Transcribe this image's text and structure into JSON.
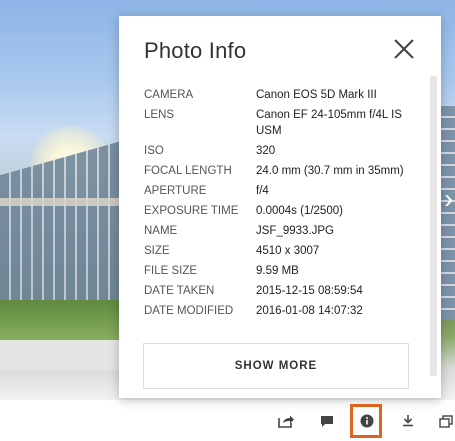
{
  "panel": {
    "title": "Photo Info",
    "rows": [
      {
        "label": "CAMERA",
        "value": "Canon EOS 5D Mark III"
      },
      {
        "label": "LENS",
        "value": "Canon EF 24-105mm f/4L IS USM"
      },
      {
        "label": "ISO",
        "value": "320"
      },
      {
        "label": "FOCAL LENGTH",
        "value": "24.0 mm (30.7 mm in 35mm)"
      },
      {
        "label": "APERTURE",
        "value": "f/4"
      },
      {
        "label": "EXPOSURE TIME",
        "value": "0.0004s (1/2500)"
      },
      {
        "label": "NAME",
        "value": "JSF_9933.JPG"
      },
      {
        "label": "SIZE",
        "value": "4510 x 3007"
      },
      {
        "label": "FILE SIZE",
        "value": "9.59 MB"
      },
      {
        "label": "DATE TAKEN",
        "value": "2015-12-15 08:59:54"
      },
      {
        "label": "DATE MODIFIED",
        "value": "2016-01-08 14:07:32"
      }
    ],
    "show_more_label": "SHOW MORE"
  },
  "toolbar": {
    "icons": [
      "share-icon",
      "comment-icon",
      "info-icon",
      "download-icon",
      "more-icon"
    ],
    "highlighted": "info-icon",
    "highlight_color": "#e0631f"
  }
}
